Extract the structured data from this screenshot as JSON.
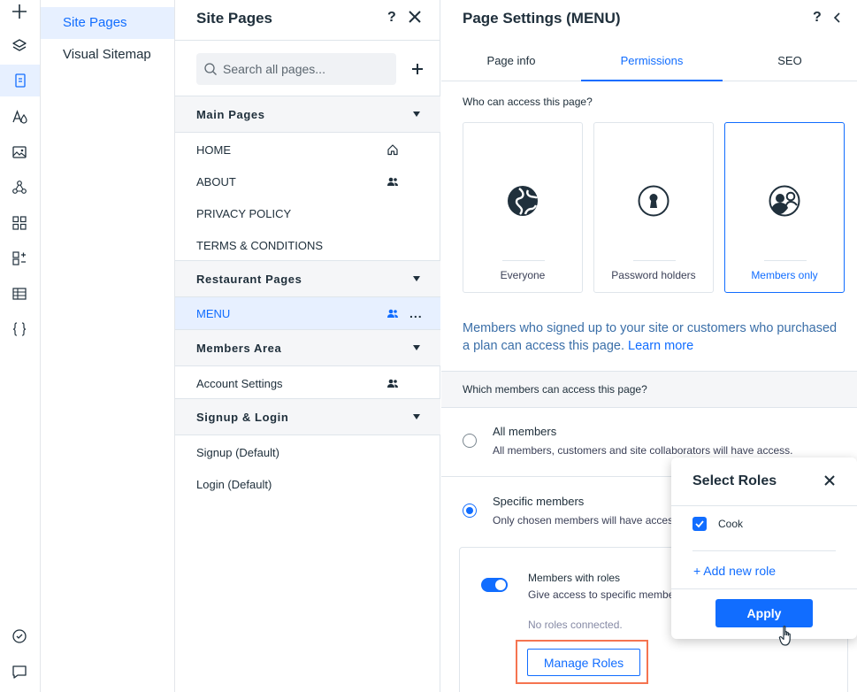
{
  "rail": {
    "icons": [
      "plus-icon",
      "layers-icon",
      "pages-icon",
      "theme-icon",
      "media-icon",
      "apps-icon",
      "grid-icon",
      "business-icon",
      "table-icon",
      "code-icon",
      "check-icon",
      "chat-icon"
    ]
  },
  "subnav": {
    "items": [
      {
        "label": "Site Pages",
        "active": true
      },
      {
        "label": "Visual Sitemap",
        "active": false
      }
    ]
  },
  "pages_panel": {
    "title": "Site Pages",
    "help": "?",
    "search_placeholder": "Search all pages...",
    "sections": [
      {
        "title": "Main Pages",
        "pages": [
          {
            "label": "HOME",
            "icon": "home-icon"
          },
          {
            "label": "ABOUT",
            "icon": "members-icon"
          },
          {
            "label": "PRIVACY POLICY"
          },
          {
            "label": "TERMS & CONDITIONS"
          }
        ]
      },
      {
        "title": "Restaurant Pages",
        "pages": [
          {
            "label": "MENU",
            "icon": "members-icon",
            "selected": true,
            "more": "..."
          }
        ]
      },
      {
        "title": "Members Area",
        "pages": [
          {
            "label": "Account Settings",
            "icon": "members-icon"
          }
        ]
      },
      {
        "title": "Signup & Login",
        "pages": [
          {
            "label": "Signup (Default)"
          },
          {
            "label": "Login (Default)"
          }
        ]
      }
    ]
  },
  "settings": {
    "title": "Page Settings (MENU)",
    "help": "?",
    "tabs": [
      {
        "label": "Page info",
        "active": false
      },
      {
        "label": "Permissions",
        "active": true
      },
      {
        "label": "SEO",
        "active": false
      }
    ],
    "question": "Who can access this page?",
    "access_options": [
      {
        "label": "Everyone",
        "icon": "globe-icon",
        "selected": false
      },
      {
        "label": "Password holders",
        "icon": "keyhole-icon",
        "selected": false
      },
      {
        "label": "Members only",
        "icon": "members-circle-icon",
        "selected": true
      }
    ],
    "info_text": "Members who signed up to your site or customers who purchased a plan can access this page.",
    "learn_more": "Learn more",
    "which_members": "Which members can access this page?",
    "options": [
      {
        "title": "All members",
        "desc": "All members, customers and site collaborators will have access.",
        "selected": false
      },
      {
        "title": "Specific members",
        "desc": "Only chosen members will have access",
        "selected": true
      }
    ],
    "roles_box": {
      "title": "Members with roles",
      "desc": "Give access to specific members",
      "toggle_on": true,
      "empty": "No roles connected.",
      "manage_button": "Manage Roles"
    }
  },
  "popup": {
    "title": "Select Roles",
    "roles": [
      {
        "label": "Cook",
        "checked": true
      }
    ],
    "add_role": "+ Add new role",
    "apply": "Apply"
  },
  "colors": {
    "accent": "#116dff",
    "highlight": "#f57450",
    "selected_bg": "#e7f0ff",
    "text": "#20303c"
  }
}
